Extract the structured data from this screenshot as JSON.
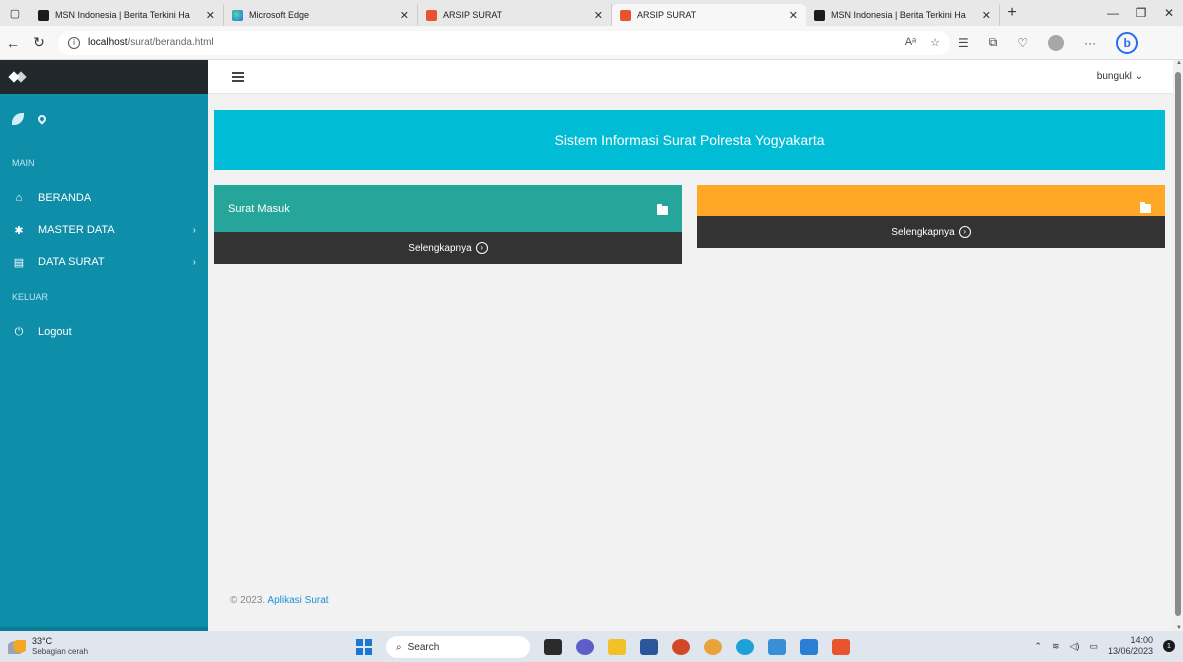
{
  "browser": {
    "tabs": [
      {
        "title": "MSN Indonesia | Berita Terkini Ha",
        "icon": "msn-icon",
        "active": false
      },
      {
        "title": "Microsoft Edge",
        "icon": "edge-icon",
        "active": false
      },
      {
        "title": "ARSIP SURAT",
        "icon": "xampp-icon",
        "active": false
      },
      {
        "title": "ARSIP SURAT",
        "icon": "xampp-icon",
        "active": true
      },
      {
        "title": "MSN Indonesia | Berita Terkini Ha",
        "icon": "msn-icon",
        "active": false
      }
    ],
    "url_host": "localhost",
    "url_path": "/surat/beranda.html"
  },
  "sidebar": {
    "section_main": "MAIN",
    "section_logout": "KELUAR",
    "items": [
      {
        "label": "BERANDA",
        "icon": "home-icon"
      },
      {
        "label": "MASTER DATA",
        "icon": "gear-icon",
        "chevron": "›"
      },
      {
        "label": "DATA SURAT",
        "icon": "document-icon",
        "chevron": "›"
      }
    ],
    "logout_label": "Logout"
  },
  "topbar": {
    "user_name": "bungukl",
    "user_chevron": "⌄"
  },
  "main": {
    "banner_title": "Sistem Informasi Surat Polresta Yogyakarta",
    "cards": [
      {
        "title": "Surat Masuk",
        "link_label": "Selengkapnya",
        "color": "#26a69a"
      },
      {
        "title": "",
        "link_label": "Selengkapnya",
        "color": "#ffa726"
      }
    ],
    "footer_year": "© 2023.",
    "footer_link": "Aplikasi Surat"
  },
  "taskbar": {
    "temperature": "33°C",
    "weather": "Sebagian cerah",
    "search_label": "Search",
    "time": "14:00",
    "date": "13/06/2023",
    "notification_count": "1"
  },
  "colors": {
    "sidebar": "#0f8eaa",
    "banner": "#00bcd4",
    "card_green": "#26a69a",
    "card_orange": "#ffa726",
    "card_footer": "#333333"
  }
}
